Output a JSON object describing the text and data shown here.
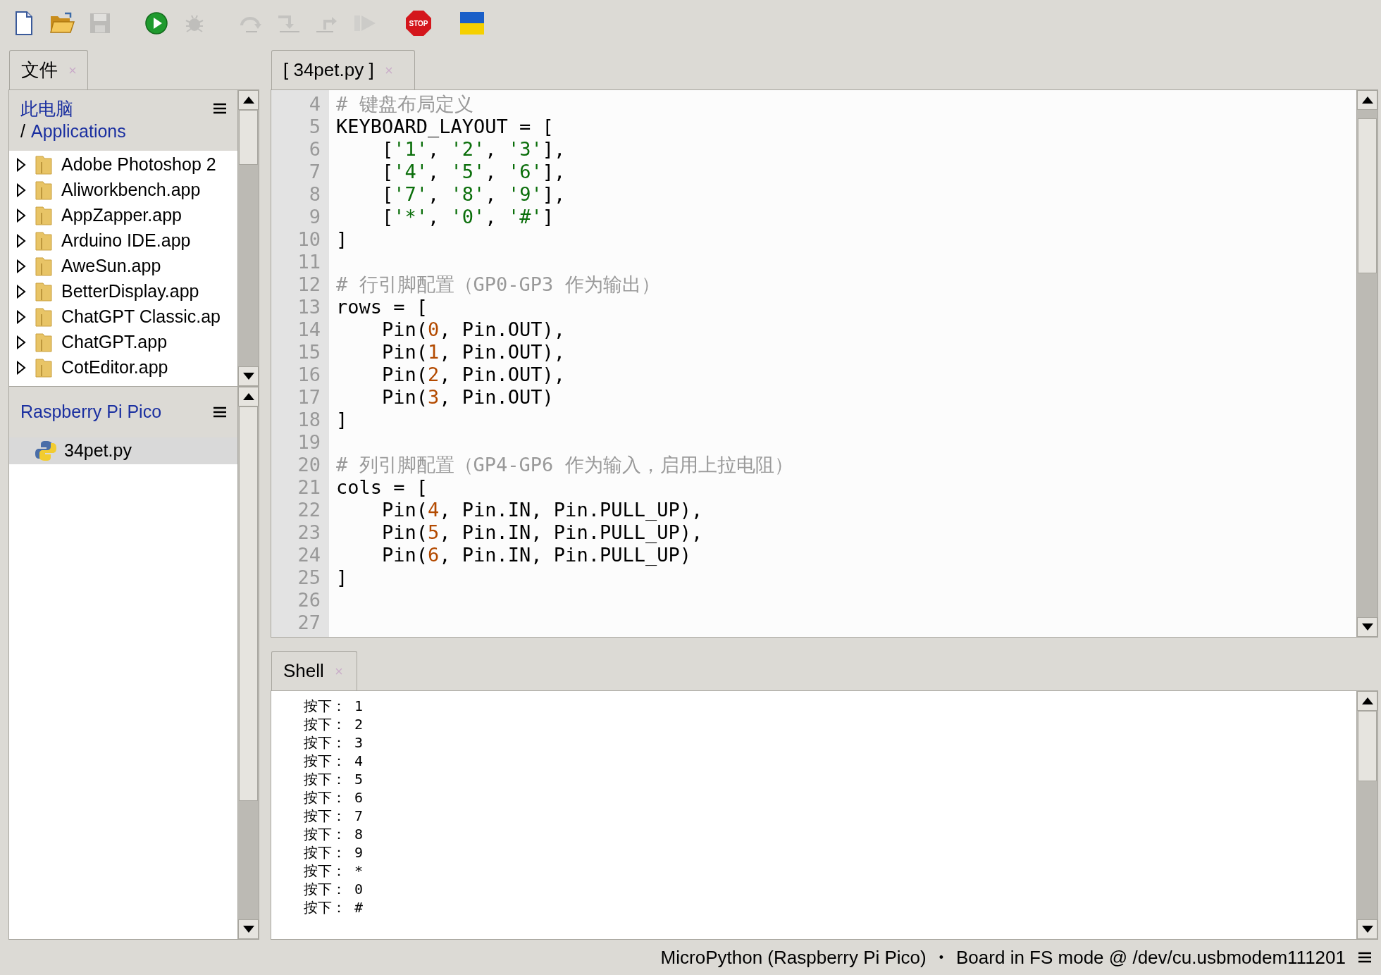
{
  "toolbar": {
    "groups": [
      {
        "buttons": [
          {
            "kind": "new",
            "disabled": false
          },
          {
            "kind": "open",
            "disabled": false
          },
          {
            "kind": "save",
            "disabled": true
          }
        ]
      },
      {
        "buttons": [
          {
            "kind": "run",
            "disabled": false
          },
          {
            "kind": "debug",
            "disabled": true
          }
        ]
      },
      {
        "buttons": [
          {
            "kind": "step_over",
            "disabled": true
          },
          {
            "kind": "step_into",
            "disabled": true
          },
          {
            "kind": "step_out",
            "disabled": true
          },
          {
            "kind": "resume",
            "disabled": true
          }
        ]
      },
      {
        "buttons": [
          {
            "kind": "stop",
            "label": "STOP",
            "disabled": false
          }
        ]
      },
      {
        "buttons": [
          {
            "kind": "flag",
            "disabled": false
          }
        ]
      }
    ]
  },
  "files_panel": {
    "tab": {
      "label": "文件",
      "selected": true
    },
    "computer": {
      "title": "此电脑",
      "path_separator": "/",
      "path": "Applications",
      "items": [
        {
          "name": "Adobe Photoshop 2",
          "expanded": false
        },
        {
          "name": "Aliworkbench.app",
          "expanded": false
        },
        {
          "name": "AppZapper.app",
          "expanded": false
        },
        {
          "name": "Arduino IDE.app",
          "expanded": false
        },
        {
          "name": "AweSun.app",
          "expanded": false
        },
        {
          "name": "BetterDisplay.app",
          "expanded": false
        },
        {
          "name": "ChatGPT Classic.ap",
          "expanded": false
        },
        {
          "name": "ChatGPT.app",
          "expanded": false
        },
        {
          "name": "CotEditor.app",
          "expanded": false
        }
      ]
    },
    "device": {
      "title": "Raspberry Pi Pico",
      "items": [
        {
          "name": "34pet.py",
          "selected": true
        }
      ]
    }
  },
  "editor": {
    "tab": {
      "label": "[ 34pet.py ]",
      "selected": true
    },
    "lines": [
      {
        "number": "4",
        "tokens": [
          {
            "kind": "comment",
            "text": "# 键盘布局定义"
          }
        ]
      },
      {
        "number": "5",
        "tokens": [
          {
            "kind": "plain",
            "text": "KEYBOARD_LAYOUT = ["
          }
        ]
      },
      {
        "number": "6",
        "tokens": [
          {
            "kind": "plain",
            "text": "    ["
          },
          {
            "kind": "string",
            "text": "'1'"
          },
          {
            "kind": "plain",
            "text": ", "
          },
          {
            "kind": "string",
            "text": "'2'"
          },
          {
            "kind": "plain",
            "text": ", "
          },
          {
            "kind": "string",
            "text": "'3'"
          },
          {
            "kind": "plain",
            "text": "],"
          }
        ]
      },
      {
        "number": "7",
        "tokens": [
          {
            "kind": "plain",
            "text": "    ["
          },
          {
            "kind": "string",
            "text": "'4'"
          },
          {
            "kind": "plain",
            "text": ", "
          },
          {
            "kind": "string",
            "text": "'5'"
          },
          {
            "kind": "plain",
            "text": ", "
          },
          {
            "kind": "string",
            "text": "'6'"
          },
          {
            "kind": "plain",
            "text": "],"
          }
        ]
      },
      {
        "number": "8",
        "tokens": [
          {
            "kind": "plain",
            "text": "    ["
          },
          {
            "kind": "string",
            "text": "'7'"
          },
          {
            "kind": "plain",
            "text": ", "
          },
          {
            "kind": "string",
            "text": "'8'"
          },
          {
            "kind": "plain",
            "text": ", "
          },
          {
            "kind": "string",
            "text": "'9'"
          },
          {
            "kind": "plain",
            "text": "],"
          }
        ]
      },
      {
        "number": "9",
        "tokens": [
          {
            "kind": "plain",
            "text": "    ["
          },
          {
            "kind": "string",
            "text": "'*'"
          },
          {
            "kind": "plain",
            "text": ", "
          },
          {
            "kind": "string",
            "text": "'0'"
          },
          {
            "kind": "plain",
            "text": ", "
          },
          {
            "kind": "string",
            "text": "'#'"
          },
          {
            "kind": "plain",
            "text": "]"
          }
        ]
      },
      {
        "number": "10",
        "tokens": [
          {
            "kind": "plain",
            "text": "]"
          }
        ]
      },
      {
        "number": "11"
      },
      {
        "number": "12",
        "tokens": [
          {
            "kind": "comment",
            "text": "# 行引脚配置（GP0-GP3 作为输出）"
          }
        ]
      },
      {
        "number": "13",
        "tokens": [
          {
            "kind": "plain",
            "text": "rows = ["
          }
        ]
      },
      {
        "number": "14",
        "tokens": [
          {
            "kind": "plain",
            "text": "    Pin("
          },
          {
            "kind": "number",
            "text": "0"
          },
          {
            "kind": "plain",
            "text": ", Pin.OUT),"
          }
        ]
      },
      {
        "number": "15",
        "tokens": [
          {
            "kind": "plain",
            "text": "    Pin("
          },
          {
            "kind": "number",
            "text": "1"
          },
          {
            "kind": "plain",
            "text": ", Pin.OUT),"
          }
        ]
      },
      {
        "number": "16",
        "tokens": [
          {
            "kind": "plain",
            "text": "    Pin("
          },
          {
            "kind": "number",
            "text": "2"
          },
          {
            "kind": "plain",
            "text": ", Pin.OUT),"
          }
        ]
      },
      {
        "number": "17",
        "tokens": [
          {
            "kind": "plain",
            "text": "    Pin("
          },
          {
            "kind": "number",
            "text": "3"
          },
          {
            "kind": "plain",
            "text": ", Pin.OUT)"
          }
        ]
      },
      {
        "number": "18",
        "tokens": [
          {
            "kind": "plain",
            "text": "]"
          }
        ]
      },
      {
        "number": "19"
      },
      {
        "number": "20",
        "tokens": [
          {
            "kind": "comment",
            "text": "# 列引脚配置（GP4-GP6 作为输入，启用上拉电阻）"
          }
        ]
      },
      {
        "number": "21",
        "tokens": [
          {
            "kind": "plain",
            "text": "cols = ["
          }
        ]
      },
      {
        "number": "22",
        "tokens": [
          {
            "kind": "plain",
            "text": "    Pin("
          },
          {
            "kind": "number",
            "text": "4"
          },
          {
            "kind": "plain",
            "text": ", Pin.IN, Pin.PULL_UP),"
          }
        ]
      },
      {
        "number": "23",
        "tokens": [
          {
            "kind": "plain",
            "text": "    Pin("
          },
          {
            "kind": "number",
            "text": "5"
          },
          {
            "kind": "plain",
            "text": ", Pin.IN, Pin.PULL_UP),"
          }
        ]
      },
      {
        "number": "24",
        "tokens": [
          {
            "kind": "plain",
            "text": "    Pin("
          },
          {
            "kind": "number",
            "text": "6"
          },
          {
            "kind": "plain",
            "text": ", Pin.IN, Pin.PULL_UP)"
          }
        ]
      },
      {
        "number": "25",
        "tokens": [
          {
            "kind": "plain",
            "text": "]"
          }
        ]
      },
      {
        "number": "26"
      },
      {
        "number": "27"
      }
    ]
  },
  "shell": {
    "tab": {
      "label": "Shell",
      "selected": true
    },
    "lines": [
      "按下： 1",
      "按下： 2",
      "按下： 3",
      "按下： 4",
      "按下： 5",
      "按下： 6",
      "按下： 7",
      "按下： 8",
      "按下： 9",
      "按下： *",
      "按下： 0",
      "按下： #"
    ]
  },
  "status_bar": {
    "interpreter": "MicroPython (Raspberry Pi Pico)",
    "separator": "•",
    "port": "Board in FS mode @ /dev/cu.usbmodem111201"
  }
}
